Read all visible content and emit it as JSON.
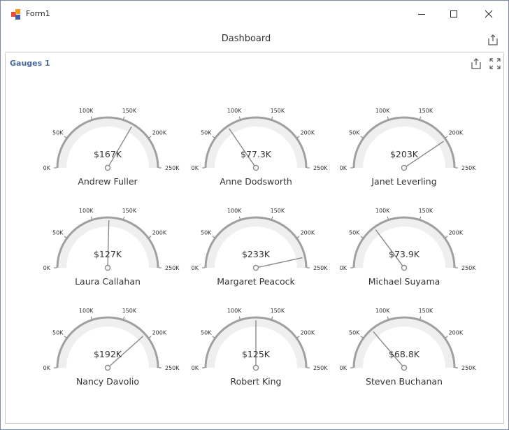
{
  "window": {
    "title": "Form1"
  },
  "dashboard": {
    "title": "Dashboard",
    "export_icon": "export-icon"
  },
  "panel": {
    "title": "Gauges 1",
    "export_icon": "export-icon",
    "maximize_icon": "maximize-icon"
  },
  "gauge_scale": {
    "min": 0,
    "max": 250000,
    "tick_labels": [
      "0K",
      "50K",
      "100K",
      "150K",
      "200K",
      "250K"
    ]
  },
  "colors": {
    "arc": "#a0a0a0",
    "band": "#efefef",
    "needle": "#8a8a8a",
    "text": "#333333",
    "panel_title": "#4a6a9a"
  },
  "gauges": [
    {
      "name": "Andrew Fuller",
      "value_label": "$167K",
      "value": 167000
    },
    {
      "name": "Anne Dodsworth",
      "value_label": "$77.3K",
      "value": 77300
    },
    {
      "name": "Janet Leverling",
      "value_label": "$203K",
      "value": 203000
    },
    {
      "name": "Laura Callahan",
      "value_label": "$127K",
      "value": 127000
    },
    {
      "name": "Margaret Peacock",
      "value_label": "$233K",
      "value": 233000
    },
    {
      "name": "Michael Suyama",
      "value_label": "$73.9K",
      "value": 73900
    },
    {
      "name": "Nancy Davolio",
      "value_label": "$192K",
      "value": 192000
    },
    {
      "name": "Robert King",
      "value_label": "$125K",
      "value": 125000
    },
    {
      "name": "Steven Buchanan",
      "value_label": "$68.8K",
      "value": 68800
    }
  ]
}
